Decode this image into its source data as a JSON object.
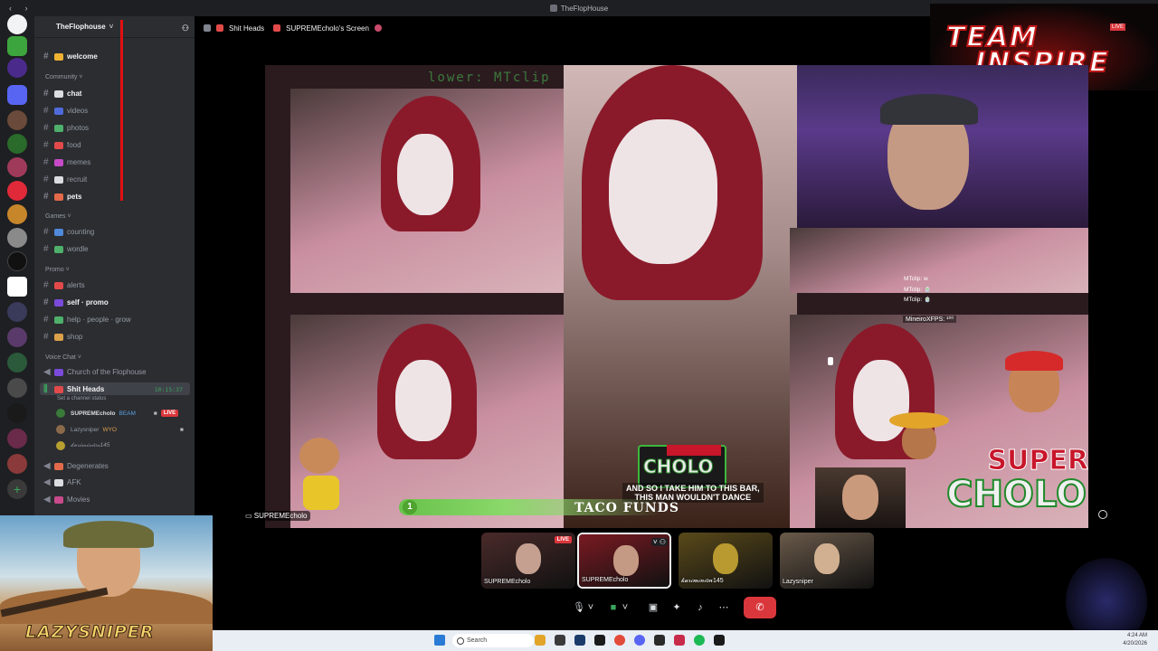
{
  "window": {
    "title": "TheFlopHouse"
  },
  "guild": {
    "name": "TheFlophouse",
    "add_icon": "add-member-icon"
  },
  "channels": {
    "top": [
      {
        "label": "welcome",
        "bright": true,
        "color": "#f0b232"
      }
    ],
    "community_label": "Community",
    "community": [
      {
        "label": "chat",
        "bright": true,
        "color": "#dbdee1"
      },
      {
        "label": "videos",
        "bright": false,
        "color": "#4f6bdb"
      },
      {
        "label": "photos",
        "bright": false,
        "color": "#4fb06b"
      },
      {
        "label": "food",
        "bright": false,
        "color": "#e24a4a"
      },
      {
        "label": "memes",
        "bright": false,
        "color": "#c84ac8"
      },
      {
        "label": "recruit",
        "bright": false,
        "color": "#dbdee1"
      },
      {
        "label": "pets",
        "bright": true,
        "color": "#e26a4a"
      }
    ],
    "games_label": "Games",
    "games": [
      {
        "label": "counting",
        "bright": false,
        "color": "#4f8adb"
      },
      {
        "label": "wordle",
        "bright": false,
        "color": "#4fb06b"
      }
    ],
    "promo_label": "Promo",
    "promo": [
      {
        "label": "alerts",
        "bright": false,
        "color": "#e24a4a"
      },
      {
        "label": "self · promo",
        "bright": true,
        "color": "#7a4adb"
      },
      {
        "label": "help · people · grow",
        "bright": false,
        "color": "#4fb06b"
      },
      {
        "label": "shop",
        "bright": false,
        "color": "#dba04a"
      }
    ],
    "voice_label": "Voice Chat",
    "voice": [
      {
        "label": "Church of the Flophouse",
        "active": false
      },
      {
        "label": "Shit Heads",
        "active": true,
        "timer": "10:15:37",
        "status": "Set a channel status"
      },
      {
        "label": "Degenerates",
        "active": false
      },
      {
        "label": "AFK",
        "active": false
      },
      {
        "label": "Movies",
        "active": false
      }
    ],
    "voice_users": [
      {
        "name": "SUPREMEcholo",
        "tag": "BEAM",
        "live": "LIVE"
      },
      {
        "name": "Lazysniper",
        "tag": "WYO",
        "live": ""
      },
      {
        "name": "𝓀𝓊𝓇𝒾𝓂𝒾𝓃𝒾𝑜𝓃145",
        "tag": "",
        "live": ""
      }
    ]
  },
  "topbar": {
    "channel": "Shit Heads",
    "screen": "SUPREMEcholo's Screen"
  },
  "banner": {
    "line1": "TEAM",
    "line2": "INSPIRE",
    "live": "LIVE"
  },
  "stream": {
    "overlay_top": "lower: MTclip",
    "chat": [
      "MTclip: w",
      "MTclip: 🍵",
      "MTclip: 🍵"
    ],
    "mineiro": "MineiroXFPS: ¹⁰⁰",
    "caption_1": "AND SO I TAKE HIM TO THIS BAR,",
    "caption_2": "THIS MAN WOULDN'T DANCE",
    "taco": "TACO FUNDS",
    "goal_number": "1",
    "cholo_small": "CHOLO",
    "super": "SUPER",
    "cholo_big": "CHOLO",
    "name_chip": "SUPREMEcholo"
  },
  "lazysniper_logo": "LAZYSNIPER",
  "participants": [
    {
      "name": "SUPREMEcholo",
      "live": "LIVE",
      "bg": "#4a2a2a",
      "face": "#c5a090"
    },
    {
      "name": "SUPREMEcholo",
      "live": "",
      "bg": "#7a1a22",
      "face": "#c59a84"
    },
    {
      "name": "𝓀𝓊𝓇𝒾𝓂𝒾𝓃𝒾𝑜𝓃145",
      "live": "",
      "bg": "#5a4a1a",
      "face": "#b89a30"
    },
    {
      "name": "Lazysniper",
      "live": "",
      "bg": "#6a5a4a",
      "face": "#d0b090"
    }
  ],
  "controls": [
    {
      "name": "mic-icon",
      "glyph": "🎙"
    },
    {
      "name": "mic-options-icon",
      "glyph": "˅"
    },
    {
      "name": "camera-icon",
      "glyph": "■"
    },
    {
      "name": "camera-options-icon",
      "glyph": "˅"
    },
    {
      "name": "share-screen-icon",
      "glyph": "▣"
    },
    {
      "name": "activities-icon",
      "glyph": "✦"
    },
    {
      "name": "soundboard-icon",
      "glyph": "♪"
    },
    {
      "name": "more-icon",
      "glyph": "⋯"
    },
    {
      "name": "disconnect-icon",
      "glyph": "✆"
    }
  ],
  "taskbar": {
    "search": "Search",
    "time": "4:24 AM",
    "date": "4/20/2026"
  },
  "colors": {
    "discord_bg": "#2b2d31",
    "server_rail": "#1e1f22",
    "live_red": "#da373c",
    "accent_green": "#3db83d"
  }
}
